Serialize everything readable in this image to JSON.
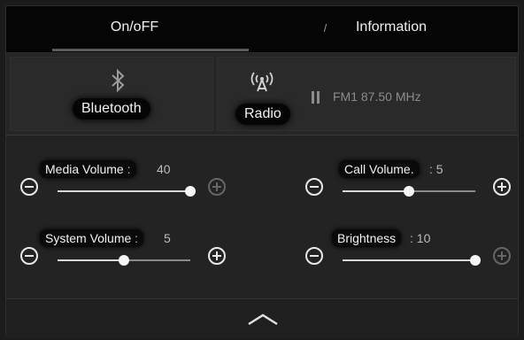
{
  "tabs": {
    "on_off": "On/oFF",
    "information": "Information"
  },
  "top": {
    "bluetooth": {
      "label": "Bluetooth",
      "icon": "bluetooth-icon"
    },
    "radio": {
      "label": "Radio",
      "icon": "radio-signal-icon",
      "frequency": "FM1 87.50 MHz",
      "pause_icon": "pause-icon"
    }
  },
  "sliders": {
    "media_volume": {
      "label": "Media Volume",
      "value": "40",
      "fraction": 1.0
    },
    "call_volume": {
      "label": "Call Volume.",
      "value": "5",
      "fraction": 0.5
    },
    "system_volume": {
      "label": "System Volume",
      "value": "5",
      "fraction": 0.5
    },
    "brightness": {
      "label": "Brightness",
      "value": "10",
      "fraction": 1.0
    }
  },
  "bottom": {
    "chevron_icon": "chevron-up-icon"
  },
  "colors": {
    "background": "#1b1b1b",
    "tab_bar": "#050505",
    "panel": "#262626",
    "accent": "#e8e8e8",
    "dim": "#666666"
  }
}
